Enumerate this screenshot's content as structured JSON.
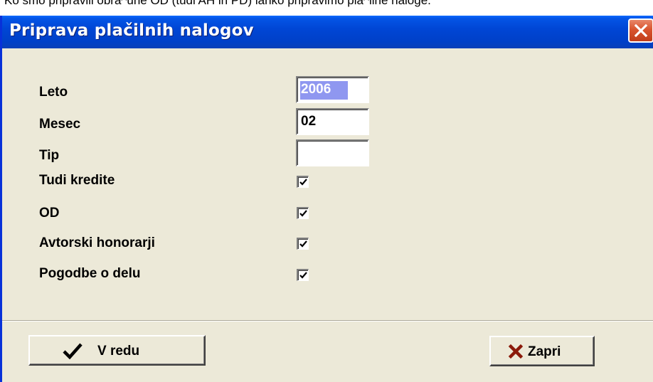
{
  "background_text": "Ko smo pripravili obra^une OD (tudi AH in PD) lahko pripravimo pla^ilne naloge.",
  "window": {
    "title": "Priprava plačilnih nalogov"
  },
  "form": {
    "leto": {
      "label": "Leto",
      "value": "2006"
    },
    "mesec": {
      "label": "Mesec",
      "value": "02"
    },
    "tip": {
      "label": "Tip",
      "value": ""
    },
    "tudi_kredite": {
      "label": "Tudi kredite",
      "checked": true
    },
    "od": {
      "label": "OD",
      "checked": true
    },
    "avtorski_honorarji": {
      "label": "Avtorski honorarji",
      "checked": true
    },
    "pogodbe_o_delu": {
      "label": "Pogodbe o delu",
      "checked": true
    }
  },
  "buttons": {
    "ok_label": "V redu",
    "close_label": "Zapri"
  },
  "colors": {
    "titlebar": "#0046d5",
    "dialog_bg": "#ece9d8",
    "selection": "#8f97f0",
    "close_button": "#d9542e",
    "ok_check_icon": "#000000",
    "close_x_icon": "#8b1a0a"
  },
  "icons": {
    "ok": "checkmark-icon",
    "close": "x-icon",
    "titlebar_close": "close-icon"
  }
}
